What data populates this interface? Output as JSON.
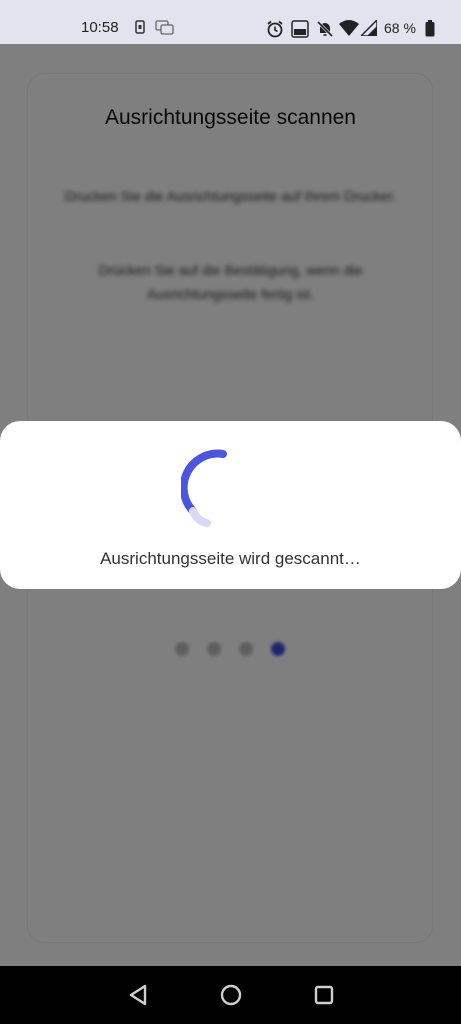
{
  "status_bar": {
    "time": "10:58",
    "battery": "68 %",
    "icons": [
      "sim-icon",
      "chat-icon",
      "alarm-icon",
      "volte-icon",
      "mute-icon",
      "wifi-icon",
      "signal-icon",
      "battery-icon"
    ]
  },
  "page": {
    "title": "Ausrichtungsseite scannen",
    "instruction_1": "Drucken Sie die Ausrichtungsseite auf Ihrem Drucker.",
    "instruction_2": "Drücken Sie auf die Bestätigung, wenn die Ausrichtungsseite fertig ist.",
    "step_dots": 4,
    "active_step": 4
  },
  "dialog": {
    "message": "Ausrichtungsseite wird gescannt…"
  },
  "colors": {
    "accent": "#3d4be0",
    "status_bar_bg": "#e3e3f0"
  },
  "nav": {
    "buttons": [
      "back-icon",
      "home-icon",
      "recents-icon"
    ]
  }
}
